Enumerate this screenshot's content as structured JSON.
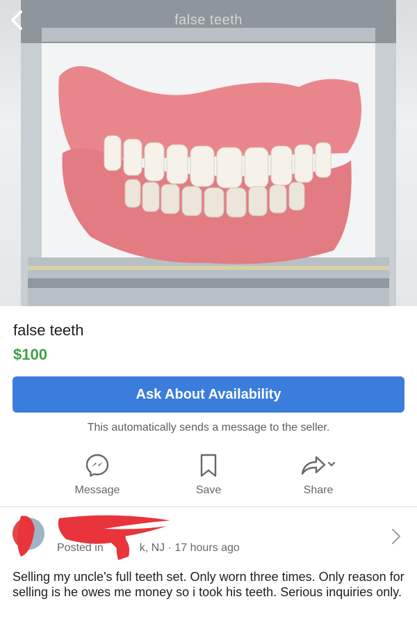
{
  "photo": {
    "overlay_title": "false teeth",
    "back_icon": "chevron-left-icon"
  },
  "listing": {
    "title": "false teeth",
    "price": "$100",
    "price_color": "#42a046"
  },
  "cta": {
    "label": "Ask About Availability",
    "note": "This automatically sends a message to the seller.",
    "color": "#3b7ddd"
  },
  "actions": [
    {
      "label": "Message",
      "icon": "messenger-icon"
    },
    {
      "label": "Save",
      "icon": "bookmark-icon"
    },
    {
      "label": "Share",
      "icon": "share-icon"
    }
  ],
  "poster": {
    "posted_prefix": "Posted in",
    "location": "k, NJ",
    "time": "17 hours ago"
  },
  "description": "Selling my uncle's full teeth set. Only worn three times. Only reason for selling is he owes me money so i took his teeth. Serious inquiries only."
}
